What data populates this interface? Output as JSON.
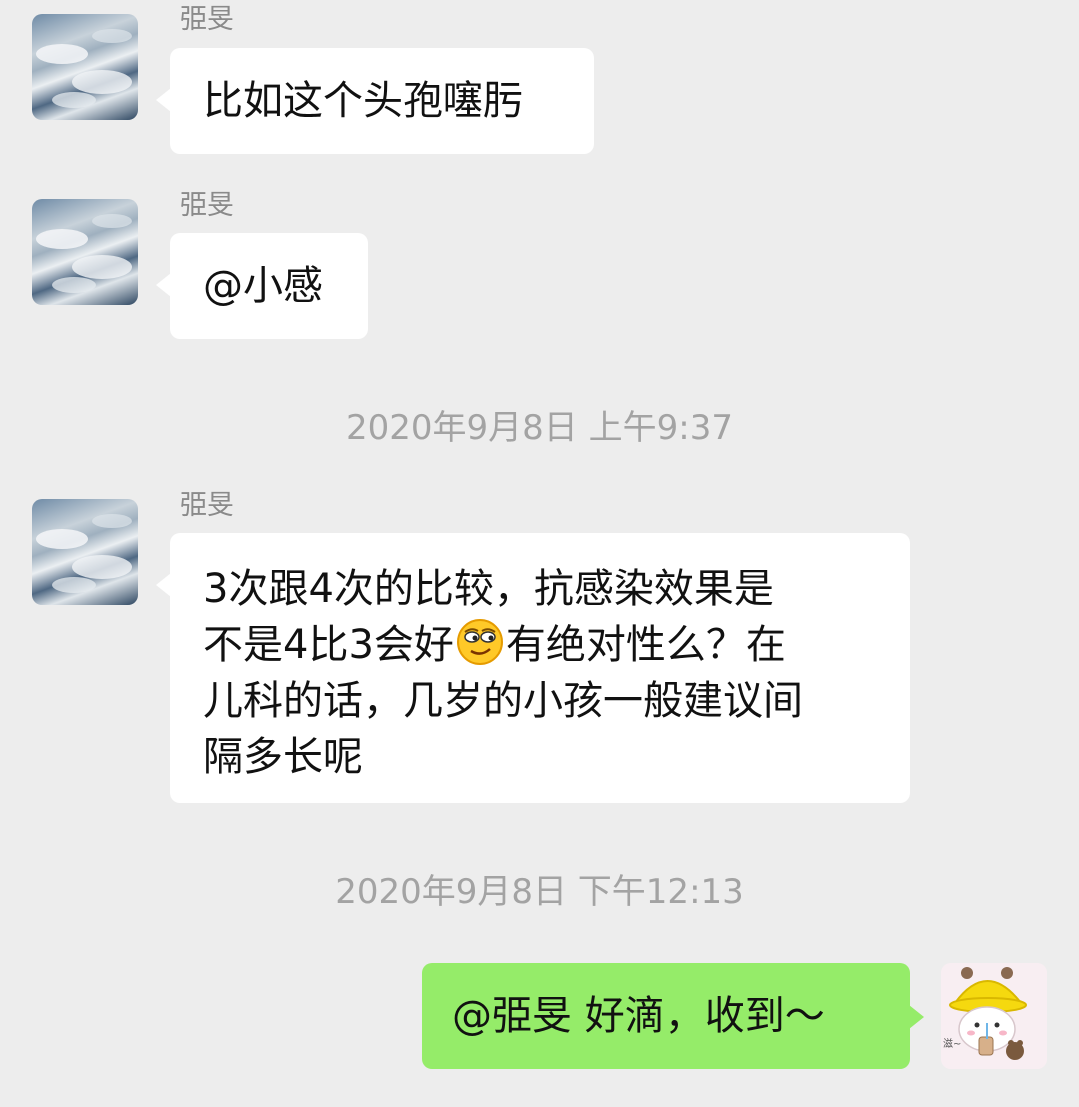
{
  "messages": [
    {
      "sender": "弫旻",
      "text": "比如这个头孢噻肟"
    },
    {
      "sender": "弫旻",
      "text": "@小感"
    },
    {
      "timestamp": "2020年9月8日 上午9:37",
      "sender": "弫旻",
      "line1": "3次跟4次的比较，抗感染效果是",
      "line2_before": "不是4比3会好",
      "emoji": "smirk-emoji",
      "line2_after": "有绝对性么？在",
      "line3": "儿科的话，几岁的小孩一般建议间",
      "line4": "隔多长呢"
    },
    {
      "timestamp": "2020年9月8日 下午12:13",
      "text": "@弫旻 好滴，收到～"
    }
  ],
  "colors": {
    "background": "#ededed",
    "incoming_bubble": "#ffffff",
    "outgoing_bubble": "#95ec69",
    "sender_name": "#8a8a8a",
    "timestamp": "#a3a3a3"
  },
  "icons": {
    "contact_avatar": "sky-clouds-avatar",
    "my_avatar": "yellow-hat-bear-avatar",
    "my_avatar_caption": "滋~"
  }
}
